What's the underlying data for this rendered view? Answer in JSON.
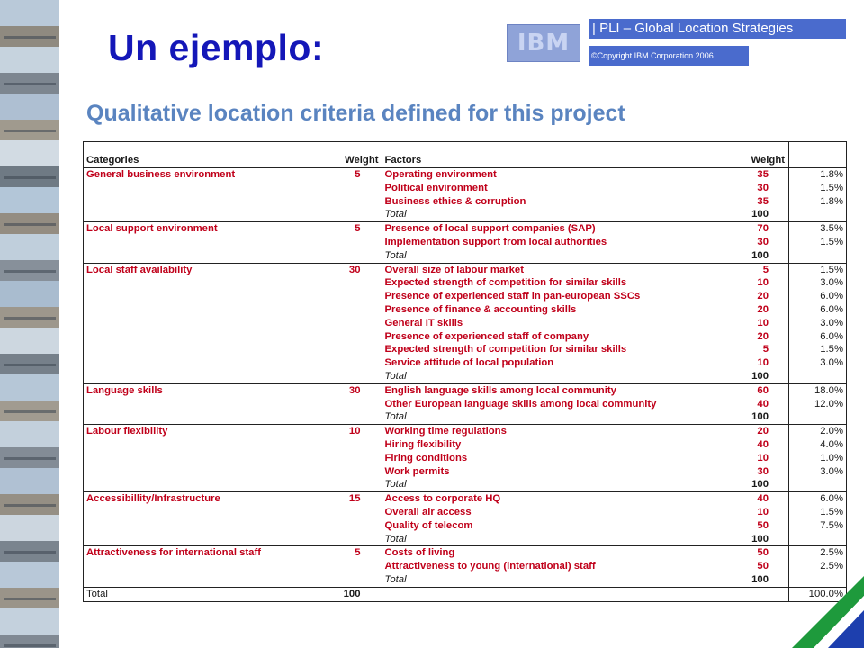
{
  "slide": {
    "title": "Un ejemplo:",
    "ibm_logo": "IBM",
    "banner": "| PLI – Global Location Strategies",
    "copyright": "©Copyright IBM Corporation 2006",
    "table_heading": "Qualitative location criteria defined for this project"
  },
  "table": {
    "headers": {
      "categories": "Categories",
      "weight": "Weight",
      "factors": "Factors",
      "factor_weight": "Weight",
      "percent": ""
    },
    "groups": [
      {
        "category": "General business environment",
        "weight": "5",
        "factors": [
          {
            "name": "Operating environment",
            "weight": "35",
            "pct": "1.8%"
          },
          {
            "name": "Political environment",
            "weight": "30",
            "pct": "1.5%"
          },
          {
            "name": "Business ethics & corruption",
            "weight": "35",
            "pct": "1.8%"
          }
        ],
        "total_label": "Total",
        "total": "100"
      },
      {
        "category": "Local support environment",
        "weight": "5",
        "factors": [
          {
            "name": "Presence of local support companies (SAP)",
            "weight": "70",
            "pct": "3.5%"
          },
          {
            "name": "Implementation support from local authorities",
            "weight": "30",
            "pct": "1.5%"
          }
        ],
        "total_label": "Total",
        "total": "100"
      },
      {
        "category": "Local staff availability",
        "weight": "30",
        "factors": [
          {
            "name": "Overall size of labour market",
            "weight": "5",
            "pct": "1.5%"
          },
          {
            "name": "Expected strength of competition for similar skills",
            "weight": "10",
            "pct": "3.0%"
          },
          {
            "name": "Presence of experienced staff in pan-european SSCs",
            "weight": "20",
            "pct": "6.0%"
          },
          {
            "name": "Presence of finance & accounting skills",
            "weight": "20",
            "pct": "6.0%"
          },
          {
            "name": "General IT skills",
            "weight": "10",
            "pct": "3.0%"
          },
          {
            "name": "Presence of experienced staff of company",
            "weight": "20",
            "pct": "6.0%"
          },
          {
            "name": "Expected strength of competition for similar skills",
            "weight": "5",
            "pct": "1.5%"
          },
          {
            "name": "Service attitude of local population",
            "weight": "10",
            "pct": "3.0%"
          }
        ],
        "total_label": "Total",
        "total": "100"
      },
      {
        "category": "Language skills",
        "weight": "30",
        "factors": [
          {
            "name": "English language skills among local community",
            "weight": "60",
            "pct": "18.0%"
          },
          {
            "name": "Other European language skills among local community",
            "weight": "40",
            "pct": "12.0%"
          }
        ],
        "total_label": "Total",
        "total": "100"
      },
      {
        "category": "Labour flexibility",
        "weight": "10",
        "factors": [
          {
            "name": "Working time regulations",
            "weight": "20",
            "pct": "2.0%"
          },
          {
            "name": "Hiring flexibility",
            "weight": "40",
            "pct": "4.0%"
          },
          {
            "name": "Firing conditions",
            "weight": "10",
            "pct": "1.0%"
          },
          {
            "name": "Work permits",
            "weight": "30",
            "pct": "3.0%"
          }
        ],
        "total_label": "Total",
        "total": "100"
      },
      {
        "category": "Accessibillity/Infrastructure",
        "weight": "15",
        "factors": [
          {
            "name": "Access to corporate HQ",
            "weight": "40",
            "pct": "6.0%"
          },
          {
            "name": "Overall air access",
            "weight": "10",
            "pct": "1.5%"
          },
          {
            "name": "Quality of telecom",
            "weight": "50",
            "pct": "7.5%"
          }
        ],
        "total_label": "Total",
        "total": "100"
      },
      {
        "category": "Attractiveness for international staff",
        "weight": "5",
        "factors": [
          {
            "name": "Costs of living",
            "weight": "50",
            "pct": "2.5%"
          },
          {
            "name": "Attractiveness to young (international) staff",
            "weight": "50",
            "pct": "2.5%"
          }
        ],
        "total_label": "Total",
        "total": "100"
      }
    ],
    "grand_total": {
      "label": "Total",
      "weight": "100",
      "pct": "100.0%"
    }
  },
  "colors": {
    "title": "#1417b8",
    "heading": "#5a84c0",
    "red_text": "#c0001a",
    "banner_bg": "#4a6bcd",
    "corner_green": "#1e9a3c",
    "corner_blue": "#1d3fae"
  }
}
